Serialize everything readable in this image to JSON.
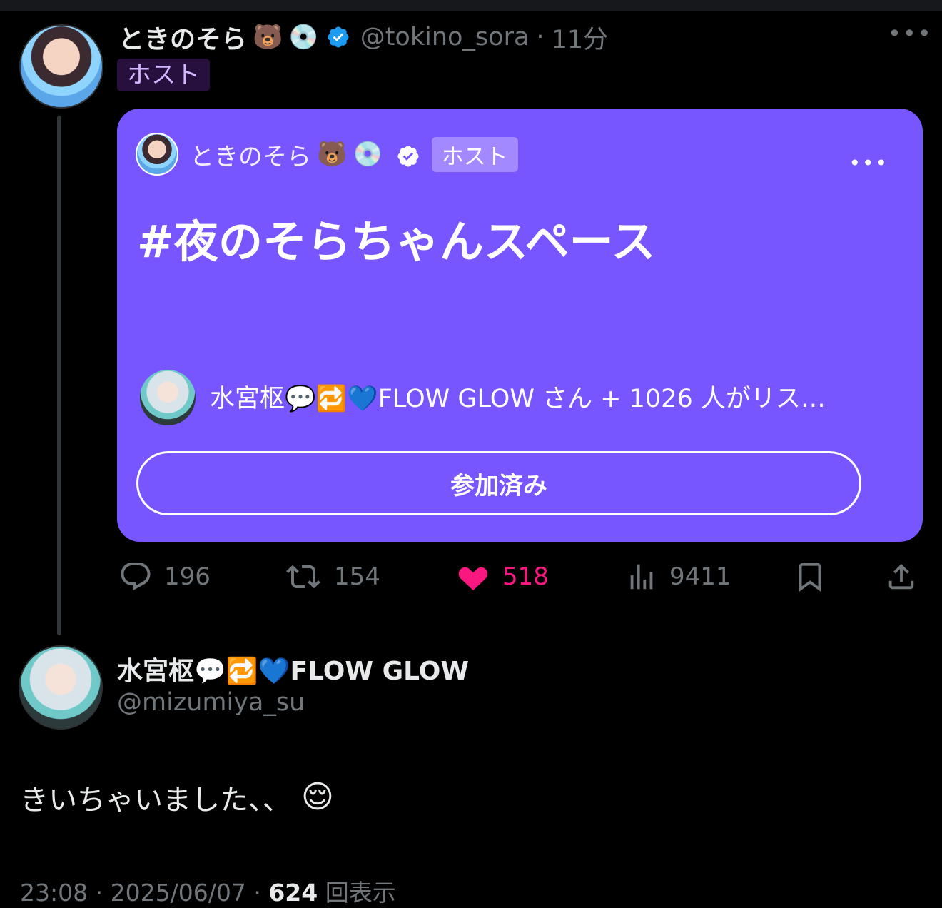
{
  "parent": {
    "name": "ときのそら",
    "emojis": [
      "🐻",
      "💿"
    ],
    "handle": "@tokino_sora",
    "separator": "·",
    "time": "11分",
    "host_badge": "ホスト",
    "more": "•••"
  },
  "space": {
    "host_name": "ときのそら",
    "host_emojis": [
      "🐻",
      "💿"
    ],
    "badge": "ホスト",
    "more": "•••",
    "title": "#夜のそらちゃんスペース",
    "listeners_text": "水宮枢💬🔁💙FLOW GLOW さん + 1026 人がリス…",
    "join_button": "参加済み",
    "accent": "#7856ff"
  },
  "actions": {
    "replies": "196",
    "retweets": "154",
    "likes": "518",
    "views": "9411",
    "like_color": "#f91880"
  },
  "reply": {
    "name": "水宮枢💬🔁💙FLOW GLOW",
    "handle": "@mizumiya_su",
    "text": "きいちゃいました、、",
    "emoji": "😌",
    "time": "23:08",
    "date": "2025/06/07",
    "sep1": "·",
    "sep2": "·",
    "view_count": "624",
    "view_label": "回表示"
  }
}
